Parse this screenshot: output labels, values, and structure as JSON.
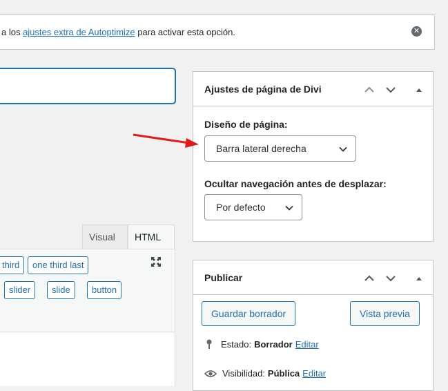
{
  "notice": {
    "prefix": "a los ",
    "link": "ajustes extra de Autoptimize",
    "suffix": " para activar esta opción."
  },
  "editor": {
    "tabs": [
      "Visual",
      "HTML"
    ],
    "quicktags_row1": [
      "third",
      "one third last"
    ],
    "quicktags_row2": [
      "slider",
      "slide",
      "button"
    ]
  },
  "divi_box": {
    "title": "Ajustes de página de Divi",
    "layout_label": "Diseño de página:",
    "layout_value": "Barra lateral derecha",
    "nav_label": "Ocultar navegación antes de desplazar:",
    "nav_value": "Por defecto"
  },
  "publish_box": {
    "title": "Publicar",
    "save_draft": "Guardar borrador",
    "preview": "Vista previa",
    "status_label": "Estado:",
    "status_value": "Borrador",
    "status_edit": "Editar",
    "visibility_label": "Visibilidad:",
    "visibility_value": "Pública",
    "visibility_edit": "Editar"
  },
  "colors": {
    "accent": "#2271b1",
    "annotation_arrow": "#e01b1b"
  },
  "icons": [
    "dismiss-icon",
    "fullscreen-icon",
    "chevron-up-icon",
    "chevron-down-icon",
    "toggle-triangle-icon",
    "pin-icon",
    "eye-icon",
    "select-chevron-icon",
    "red-arrow-annotation"
  ]
}
